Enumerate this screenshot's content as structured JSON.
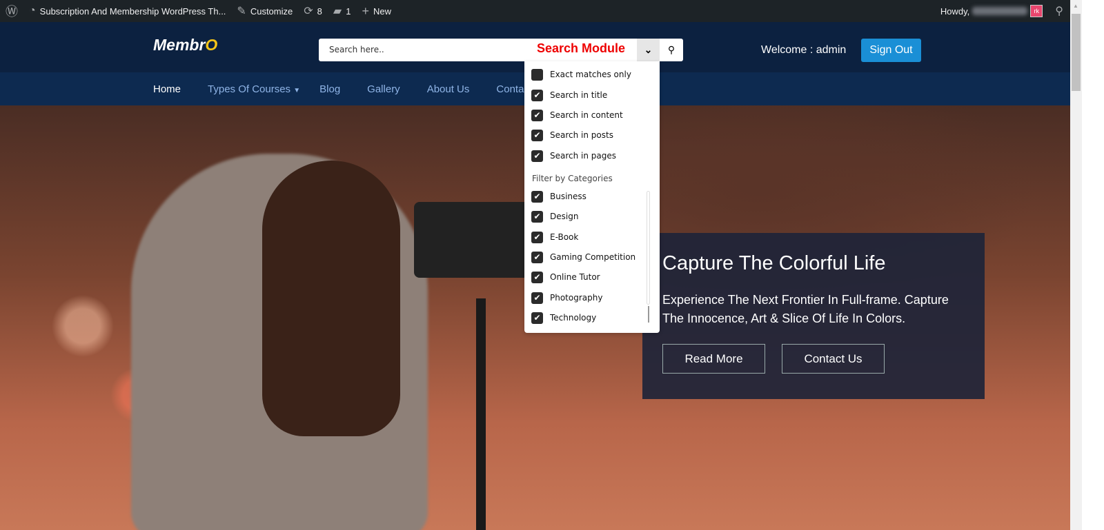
{
  "adminbar": {
    "site_title": "Subscription And Membership WordPress Th...",
    "customize": "Customize",
    "updates": "8",
    "comments": "1",
    "new": "New",
    "howdy": "Howdy,",
    "avatar_initials": "rk"
  },
  "header": {
    "logo_main": "Membr",
    "logo_accent": "O",
    "search_placeholder": "Search here..",
    "annotation": "Search Module",
    "welcome": "Welcome : admin",
    "sign_out": "Sign Out"
  },
  "nav": {
    "items": [
      "Home",
      "Types Of Courses",
      "Blog",
      "Gallery",
      "About Us",
      "Conta"
    ]
  },
  "dropdown": {
    "options": [
      {
        "label": "Exact matches only",
        "checked": false
      },
      {
        "label": "Search in title",
        "checked": true
      },
      {
        "label": "Search in content",
        "checked": true
      },
      {
        "label": "Search in posts",
        "checked": true
      },
      {
        "label": "Search in pages",
        "checked": true
      }
    ],
    "filter_label": "Filter by Categories",
    "categories": [
      {
        "label": "Business",
        "checked": true
      },
      {
        "label": "Design",
        "checked": true
      },
      {
        "label": "E-Book",
        "checked": true
      },
      {
        "label": "Gaming Competition",
        "checked": true
      },
      {
        "label": "Online Tutor",
        "checked": true
      },
      {
        "label": "Photography",
        "checked": true
      },
      {
        "label": "Technology",
        "checked": true
      }
    ]
  },
  "hero": {
    "title": "Capture The Colorful Life",
    "text": "Experience The Next Frontier In Full-frame. Capture The Innocence, Art & Slice Of Life In Colors.",
    "read_more": "Read More",
    "contact_us": "Contact Us"
  },
  "colors": {
    "header_bg": "#0c2140",
    "nav_bg": "#0d2a50",
    "accent": "#1a8fd6",
    "logo_accent": "#f5c518",
    "annotation": "#ee0000"
  }
}
